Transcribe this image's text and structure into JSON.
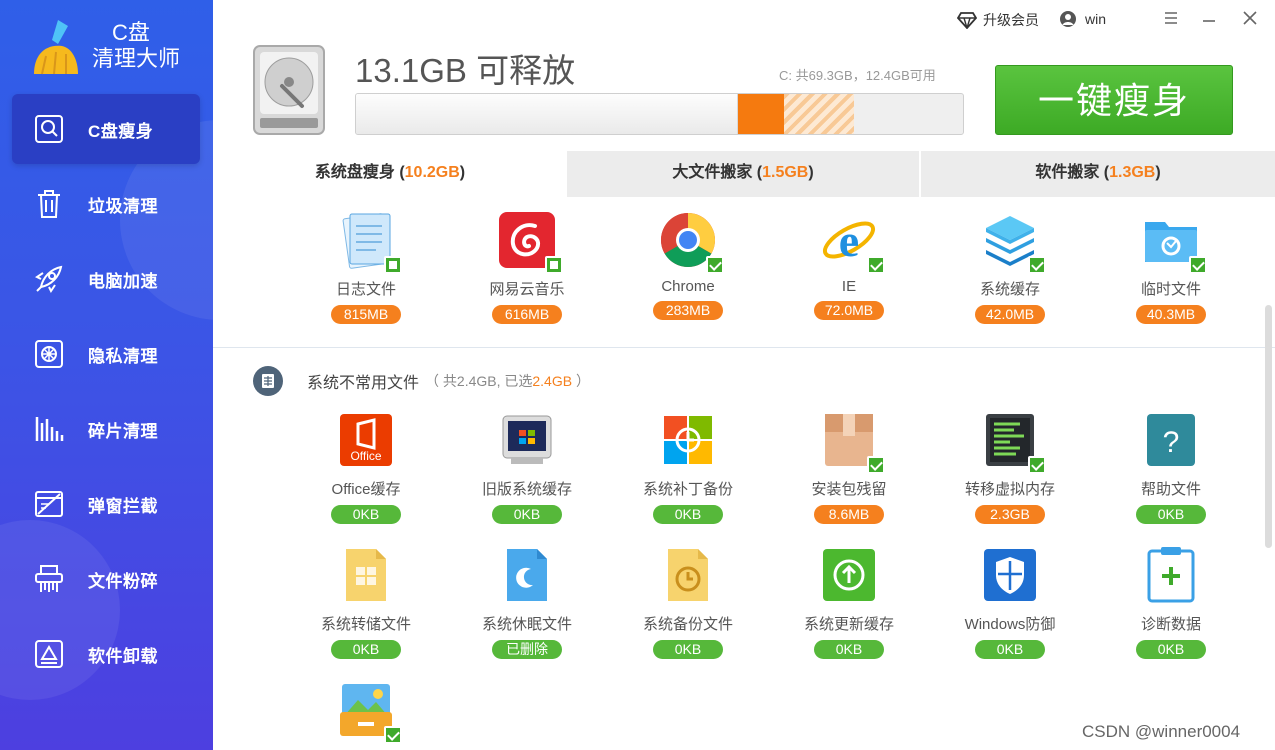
{
  "app": {
    "logo_line1": "C盘",
    "logo_line2": "清理大师"
  },
  "sidebar": {
    "items": [
      {
        "label": "C盘瘦身",
        "icon": "disk-search-icon",
        "active": true
      },
      {
        "label": "垃圾清理",
        "icon": "trash-icon"
      },
      {
        "label": "电脑加速",
        "icon": "rocket-icon"
      },
      {
        "label": "隐私清理",
        "icon": "privacy-icon"
      },
      {
        "label": "碎片清理",
        "icon": "fragment-icon"
      },
      {
        "label": "弹窗拦截",
        "icon": "popup-block-icon"
      },
      {
        "label": "文件粉碎",
        "icon": "shredder-icon"
      },
      {
        "label": "软件卸载",
        "icon": "uninstall-icon"
      }
    ]
  },
  "topbar": {
    "vip_label": "升级会员",
    "user_label": "win"
  },
  "summary": {
    "release_text": "13.1GB 可释放",
    "capacity_text": "C: 共69.3GB，12.4GB可用",
    "cta_label": "一键瘦身"
  },
  "tabs": [
    {
      "label": "系统盘瘦身 (",
      "size": "10.2GB",
      "close": ")"
    },
    {
      "label": "大文件搬家 (",
      "size": "1.5GB",
      "close": ")"
    },
    {
      "label": "软件搬家 (",
      "size": "1.3GB",
      "close": ")"
    }
  ],
  "top_items": [
    {
      "name": "日志文件",
      "size": "815MB",
      "icon": "log-file-icon"
    },
    {
      "name": "网易云音乐",
      "size": "616MB",
      "icon": "netease-music-icon"
    },
    {
      "name": "Chrome",
      "size": "283MB",
      "icon": "chrome-icon"
    },
    {
      "name": "IE",
      "size": "72.0MB",
      "icon": "ie-icon"
    },
    {
      "name": "系统缓存",
      "size": "42.0MB",
      "icon": "system-cache-icon"
    },
    {
      "name": "临时文件",
      "size": "40.3MB",
      "icon": "temp-folder-icon"
    }
  ],
  "section": {
    "title": "系统不常用文件",
    "sub_prefix": "（ 共2.4GB, 已选",
    "sub_hl": "2.4GB",
    "sub_suffix": " ）"
  },
  "rare_items": [
    {
      "name": "Office缓存",
      "size": "0KB",
      "icon": "office-icon"
    },
    {
      "name": "旧版系统缓存",
      "size": "0KB",
      "icon": "old-system-icon"
    },
    {
      "name": "系统补丁备份",
      "size": "0KB",
      "icon": "patch-backup-icon"
    },
    {
      "name": "安装包残留",
      "size": "8.6MB",
      "icon": "package-icon"
    },
    {
      "name": "转移虚拟内存",
      "size": "2.3GB",
      "icon": "virtual-memory-icon"
    },
    {
      "name": "帮助文件",
      "size": "0KB",
      "icon": "help-file-icon"
    },
    {
      "name": "系统转储文件",
      "size": "0KB",
      "icon": "dump-file-icon"
    },
    {
      "name": "系统休眠文件",
      "size": "已删除",
      "icon": "hibernate-file-icon"
    },
    {
      "name": "系统备份文件",
      "size": "0KB",
      "icon": "backup-file-icon"
    },
    {
      "name": "系统更新缓存",
      "size": "0KB",
      "icon": "update-cache-icon"
    },
    {
      "name": "Windows防御",
      "size": "0KB",
      "icon": "windows-defender-icon"
    },
    {
      "name": "诊断数据",
      "size": "0KB",
      "icon": "diagnostic-icon"
    }
  ],
  "watermark": "CSDN @winner0004",
  "colors": {
    "accent": "#f5801e",
    "green": "#3faa2b",
    "sidebar": "#3555e6"
  }
}
